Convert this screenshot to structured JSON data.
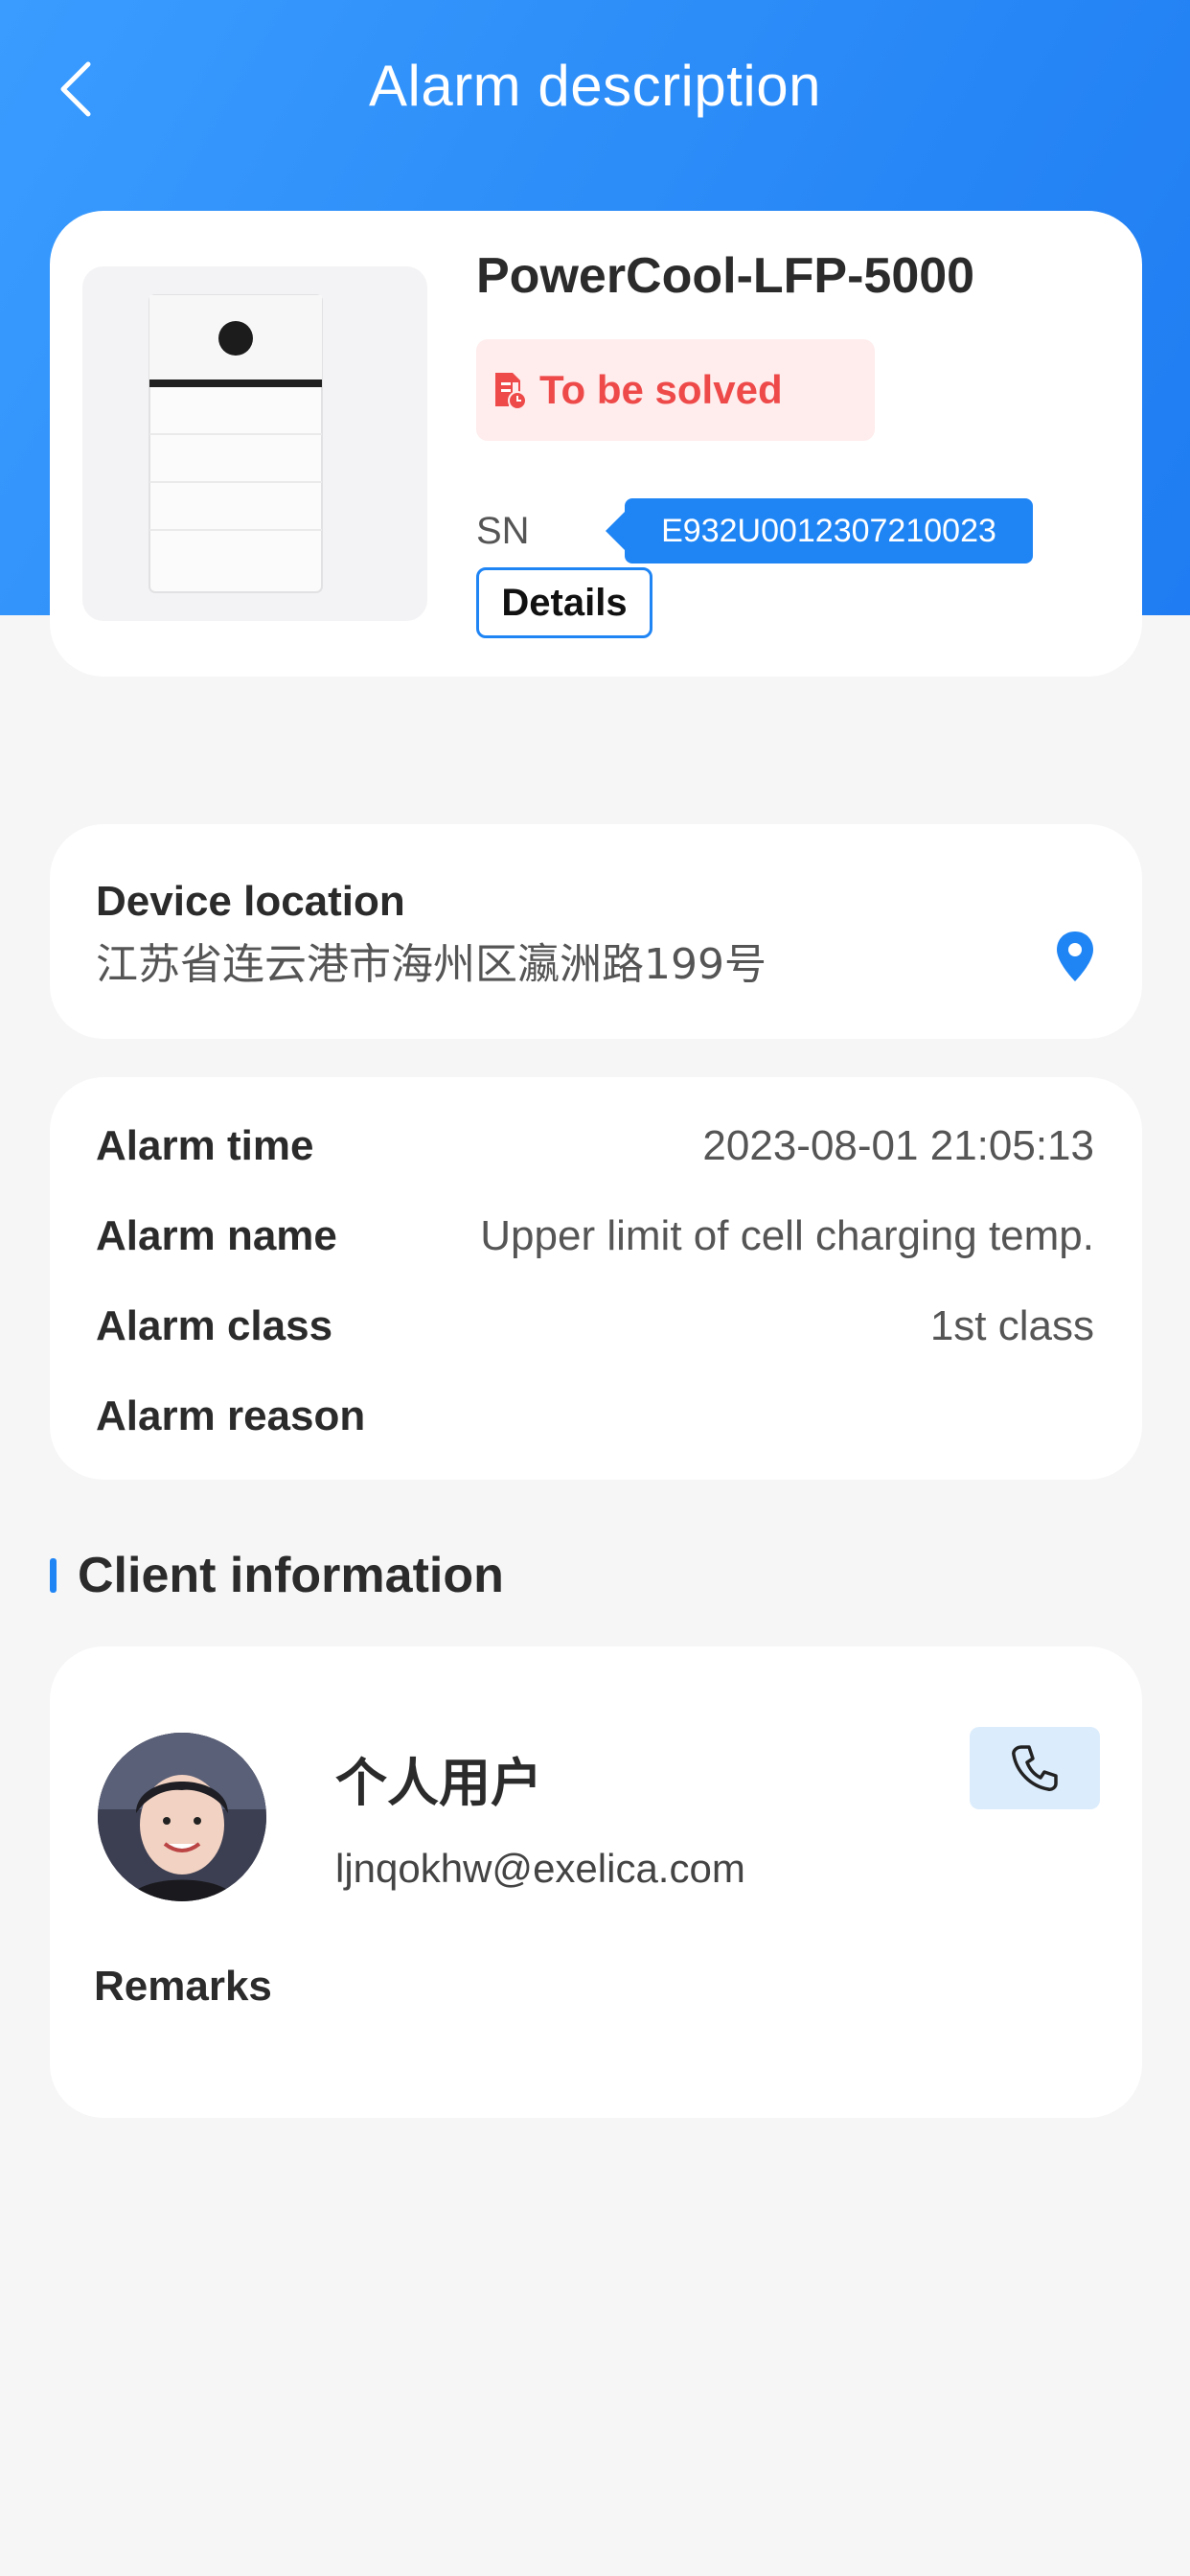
{
  "header": {
    "title": "Alarm description"
  },
  "device": {
    "name": "PowerCool-LFP-5000",
    "status": "To be solved",
    "sn_label": "SN",
    "sn_value": "E932U0012307210023",
    "details_label": "Details"
  },
  "location": {
    "label": "Device location",
    "value": "江苏省连云港市海州区瀛洲路199号"
  },
  "alarm": {
    "rows": [
      {
        "key": "Alarm time",
        "value": "2023-08-01 21:05:13"
      },
      {
        "key": "Alarm name",
        "value": "Upper limit of cell charging temp."
      },
      {
        "key": "Alarm class",
        "value": "1st class"
      },
      {
        "key": "Alarm reason",
        "value": ""
      }
    ]
  },
  "client": {
    "section_title": "Client information",
    "name": "个人用户",
    "email": "ljnqokhw@exelica.com",
    "remarks_label": "Remarks"
  },
  "colors": {
    "accent": "#1f85f5",
    "status_red": "#ee4a4a",
    "status_bg": "#ffecec"
  }
}
